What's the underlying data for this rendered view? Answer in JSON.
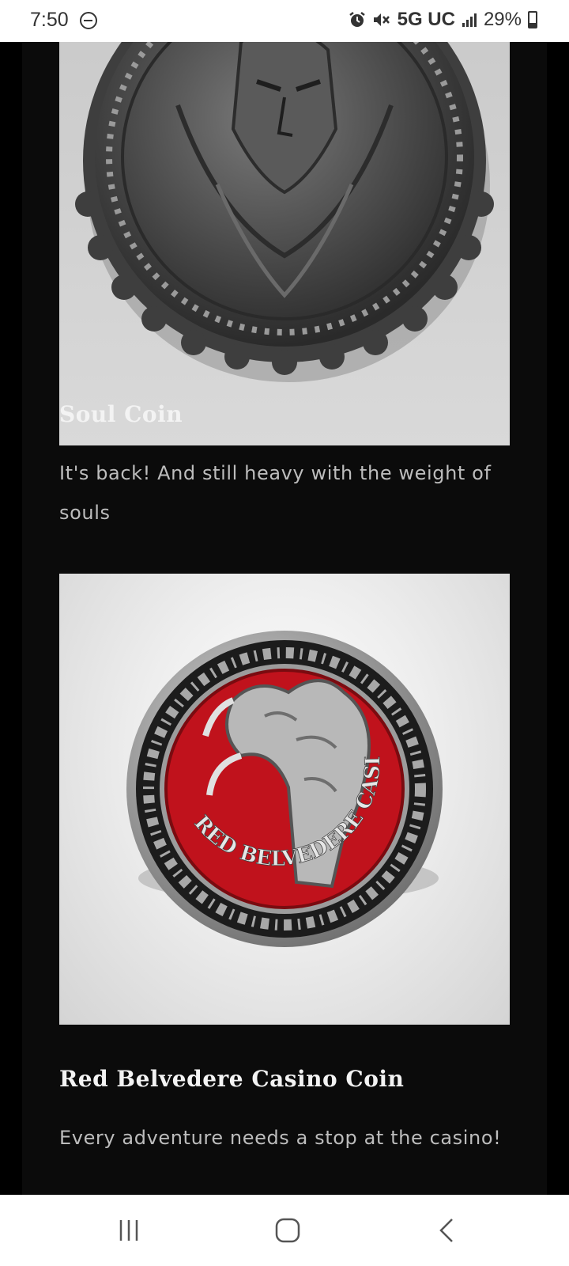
{
  "status_bar": {
    "time": "7:50",
    "network": "5G UC",
    "battery": "29%"
  },
  "products": [
    {
      "title": "Soul Coin",
      "description": "It's back! And still heavy with the weight of souls",
      "image_icon": "soul-coin-image"
    },
    {
      "title": "Red Belvedere Casino Coin",
      "description": "Every adventure needs a stop at the casino!",
      "image_icon": "red-belvedere-casino-coin-image",
      "coin_text": "RED BELVEDERE CASINO"
    }
  ],
  "colors": {
    "background": "#000000",
    "card": "#0b0b0b",
    "title": "#f3f3f3",
    "description": "#bdbdbd",
    "coin_red": "#c0121c"
  }
}
